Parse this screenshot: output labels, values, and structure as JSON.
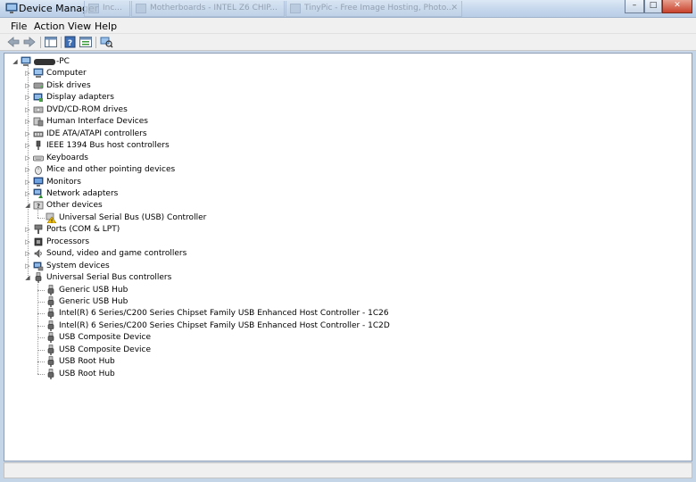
{
  "window": {
    "title": "Device Manager",
    "background_tabs": [
      {
        "label": "Inc..."
      },
      {
        "label": "Motherboards - INTEL Z6 CHIP..."
      },
      {
        "label": "TinyPic - Free Image Hosting, Photo..."
      }
    ],
    "caption_buttons": {
      "minimize": "–",
      "maximize": "□",
      "close": "✕"
    }
  },
  "menu": {
    "items": [
      {
        "label": "File"
      },
      {
        "label": "Action"
      },
      {
        "label": "View"
      },
      {
        "label": "Help"
      }
    ]
  },
  "toolbar": {
    "buttons": [
      {
        "icon": "back-arrow-icon"
      },
      {
        "icon": "forward-arrow-icon"
      },
      {
        "icon": "show-hide-console-tree-icon"
      },
      {
        "icon": "help-icon"
      },
      {
        "icon": "properties-icon"
      },
      {
        "icon": "scan-hardware-icon"
      }
    ]
  },
  "tree": {
    "root": {
      "label": "-PC",
      "redacted_prefix": true,
      "icon": "computer-icon",
      "expanded": true
    },
    "categories": [
      {
        "label": "Computer",
        "icon": "computer-icon",
        "expanded": false
      },
      {
        "label": "Disk drives",
        "icon": "disk-drive-icon",
        "expanded": false
      },
      {
        "label": "Display adapters",
        "icon": "display-adapter-icon",
        "expanded": false
      },
      {
        "label": "DVD/CD-ROM drives",
        "icon": "dvd-drive-icon",
        "expanded": false
      },
      {
        "label": "Human Interface Devices",
        "icon": "hid-icon",
        "expanded": false
      },
      {
        "label": "IDE ATA/ATAPI controllers",
        "icon": "ide-controller-icon",
        "expanded": false
      },
      {
        "label": "IEEE 1394 Bus host controllers",
        "icon": "ieee1394-icon",
        "expanded": false
      },
      {
        "label": "Keyboards",
        "icon": "keyboard-icon",
        "expanded": false
      },
      {
        "label": "Mice and other pointing devices",
        "icon": "mouse-icon",
        "expanded": false
      },
      {
        "label": "Monitors",
        "icon": "monitor-icon",
        "expanded": false
      },
      {
        "label": "Network adapters",
        "icon": "network-adapter-icon",
        "expanded": false
      },
      {
        "label": "Other devices",
        "icon": "other-devices-icon",
        "expanded": true,
        "children": [
          {
            "label": "Universal Serial Bus (USB) Controller",
            "icon": "warning-device-icon"
          }
        ]
      },
      {
        "label": "Ports (COM & LPT)",
        "icon": "port-icon",
        "expanded": false
      },
      {
        "label": "Processors",
        "icon": "processor-icon",
        "expanded": false
      },
      {
        "label": "Sound, video and game controllers",
        "icon": "sound-icon",
        "expanded": false
      },
      {
        "label": "System devices",
        "icon": "system-devices-icon",
        "expanded": false
      },
      {
        "label": "Universal Serial Bus controllers",
        "icon": "usb-icon",
        "expanded": true,
        "children": [
          {
            "label": "Generic USB Hub",
            "icon": "usb-icon"
          },
          {
            "label": "Generic USB Hub",
            "icon": "usb-icon"
          },
          {
            "label": "Intel(R) 6 Series/C200 Series Chipset Family USB Enhanced Host Controller - 1C26",
            "icon": "usb-icon"
          },
          {
            "label": "Intel(R) 6 Series/C200 Series Chipset Family USB Enhanced Host Controller - 1C2D",
            "icon": "usb-icon"
          },
          {
            "label": "USB Composite Device",
            "icon": "usb-icon"
          },
          {
            "label": "USB Composite Device",
            "icon": "usb-icon"
          },
          {
            "label": "USB Root Hub",
            "icon": "usb-icon"
          },
          {
            "label": "USB Root Hub",
            "icon": "usb-icon"
          }
        ]
      }
    ]
  },
  "colors": {
    "titlebar": "#c5d7ec",
    "menubar": "#f0f0f0",
    "pane": "#ffffff",
    "warning": "#f2c200"
  }
}
